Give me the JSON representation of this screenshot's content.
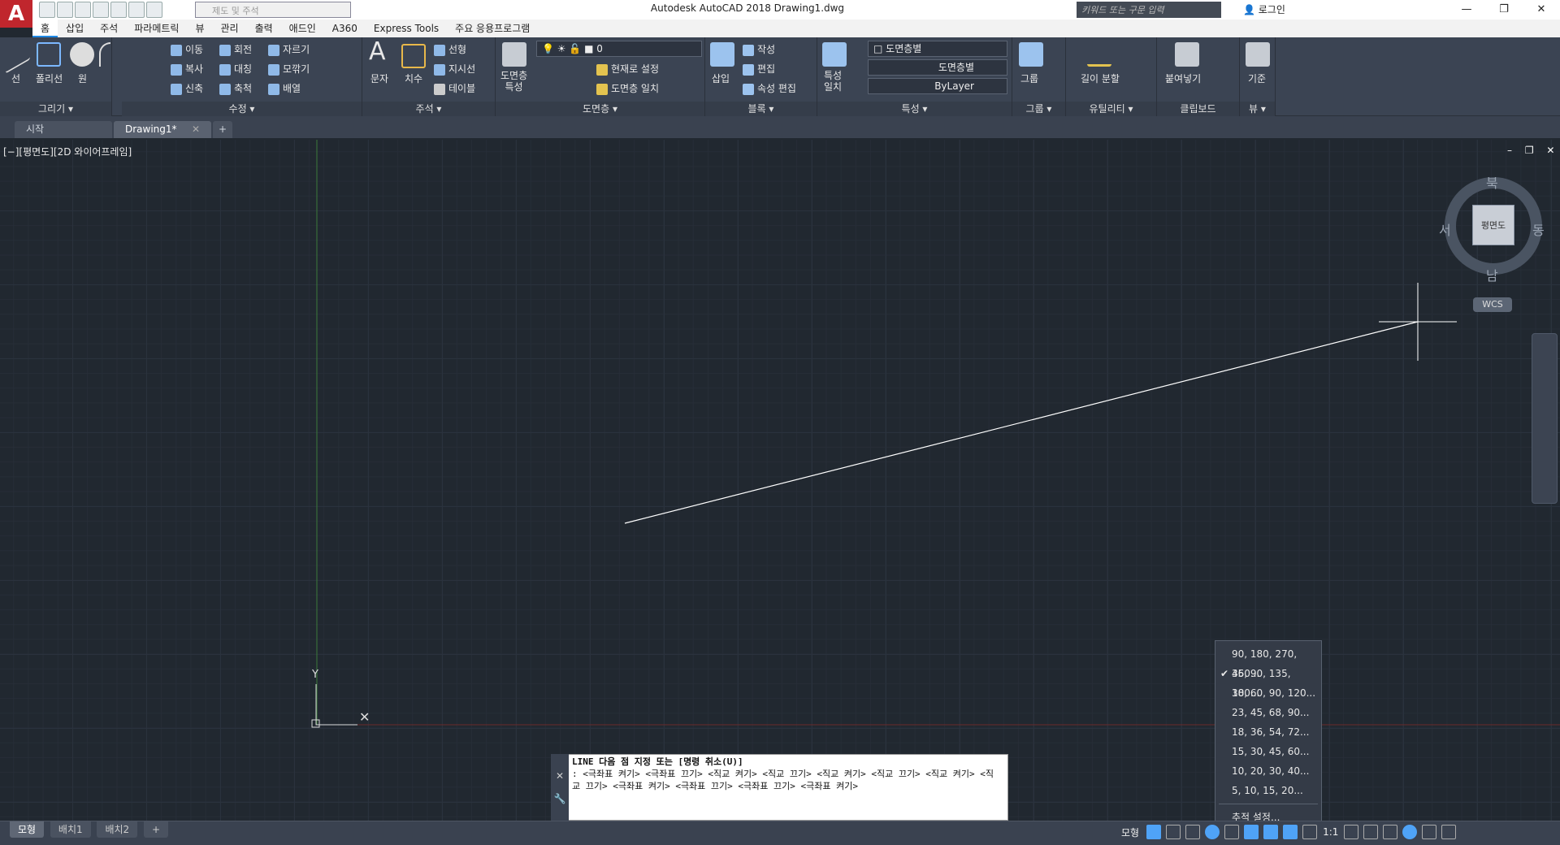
{
  "app": {
    "title": "Autodesk AutoCAD 2018    Drawing1.dwg",
    "logo": "A",
    "workspace_placeholder": "제도 및 주석",
    "search_placeholder": "키워드 또는 구문 입력",
    "login": "로그인"
  },
  "menu": {
    "tabs": [
      "홈",
      "삽입",
      "주석",
      "파라메트릭",
      "뷰",
      "관리",
      "출력",
      "애드인",
      "A360",
      "Express Tools",
      "주요 응용프로그램"
    ]
  },
  "ribbon": {
    "draw": {
      "title": "그리기 ▾",
      "line": "선",
      "polyline": "폴리선",
      "circle": "원",
      "arc": "호"
    },
    "modify": {
      "title": "수정 ▾",
      "move": "이동",
      "rotate": "회전",
      "trim": "자르기",
      "copy": "복사",
      "mirror": "대칭",
      "fillet": "모깎기",
      "stretch": "신축",
      "scale": "축척",
      "array": "배열"
    },
    "annotation": {
      "title": "주석 ▾",
      "text": "문자",
      "dimension": "치수",
      "linear": "선형",
      "leader": "지시선",
      "table": "테이블"
    },
    "layers": {
      "title": "도면층 ▾",
      "props": "도면층\n특성",
      "layer_value": "0",
      "set_current": "현재로 설정",
      "match": "도면층 일치"
    },
    "block": {
      "title": "블록 ▾",
      "insert": "삽입",
      "create": "작성",
      "edit": "편집",
      "edit_attr": "속성 편집"
    },
    "properties": {
      "title": "특성 ▾",
      "match": "특성\n일치",
      "color": "도면층별",
      "linetype": "도면층별",
      "lineweight": "ByLayer"
    },
    "groups": {
      "title": "그룹 ▾",
      "group": "그룹"
    },
    "utilities": {
      "title": "유틸리티 ▾",
      "measure": "길이 분할"
    },
    "clipboard": {
      "title": "클립보드",
      "paste": "붙여넣기"
    },
    "view": {
      "title": "뷰 ▾",
      "base": "기준"
    }
  },
  "doc_tabs": [
    "시작",
    "Drawing1*"
  ],
  "viewport": {
    "label": "[−][평면도][2D 와이어프레임]",
    "controls": "– ❐ ✕",
    "viewcube": {
      "north": "북",
      "south": "남",
      "east": "동",
      "west": "서",
      "face": "평면도",
      "wcs": "WCS"
    }
  },
  "polar_menu": {
    "items": [
      {
        "label": "90, 180, 270, 360...",
        "checked": false
      },
      {
        "label": "45, 90, 135, 180...",
        "checked": true
      },
      {
        "label": "30, 60, 90, 120...",
        "checked": false
      },
      {
        "label": "23, 45, 68, 90...",
        "checked": false
      },
      {
        "label": "18, 36, 54, 72...",
        "checked": false
      },
      {
        "label": "15, 30, 45, 60...",
        "checked": false
      },
      {
        "label": "10, 20, 30, 40...",
        "checked": false
      },
      {
        "label": "5, 10, 15, 20...",
        "checked": false
      }
    ],
    "settings": "추적 설정..."
  },
  "command": {
    "prompt": "LINE 다음 점 지정 또는 [명령 취소(U)]",
    "history": ": <극좌표 켜기> <극좌표 끄기> <직교 켜기> <직교 끄기> <직교 켜기> <직교 끄기> <직교 켜기> <직교 끄기> <극좌표 켜기> <극좌표 끄기> <극좌표 끄기> <극좌표 켜기>"
  },
  "status": {
    "layouts": [
      "모형",
      "배치1",
      "배치2"
    ],
    "model": "모형",
    "scale": "1:1"
  }
}
